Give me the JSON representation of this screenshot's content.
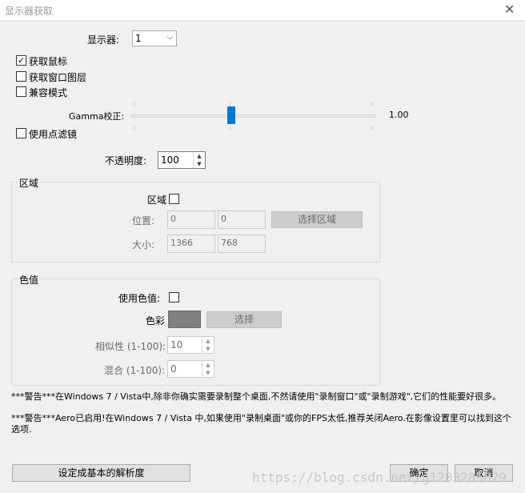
{
  "window": {
    "title": "显示器获取",
    "close_glyph": "✕"
  },
  "display": {
    "label": "显示器:",
    "selected": "1",
    "arrow": "⌵"
  },
  "options": {
    "capture_cursor": "获取鼠标",
    "capture_cursor_checked": true,
    "capture_layers": "获取窗口图层",
    "compat_mode": "兼容模式",
    "gamma_label": "Gamma校正:",
    "gamma_value": "1.00",
    "gamma_level": 0.41,
    "point_filter": "使用点滤镜",
    "opacity_label": "不透明度:",
    "opacity_value": "100",
    "check_glyph": "✓"
  },
  "region": {
    "group_label": "区域",
    "enable_label": "区域",
    "position_label": "位置:",
    "pos_x": "0",
    "pos_y": "0",
    "select_button": "选择区域",
    "size_label": "大小:",
    "width": "1366",
    "height": "768"
  },
  "color_key": {
    "group_label": "色值",
    "use_label": "使用色值:",
    "color_label": "色彩",
    "color_value": "#808080",
    "select_button": "选择",
    "similarity_label": "相似性 (1-100):",
    "similarity_value": "10",
    "blend_label": "混合 (1-100):",
    "blend_value": "0"
  },
  "warnings": {
    "line1": "***警告***在Windows 7 / Vista中,除非你确实需要录制整个桌面,不然请使用\"录制窗口\"或\"录制游戏\",它们的性能要好很多。",
    "line2": "***警告***Aero已启用!在Windows 7 / Vista 中,如果使用\"录制桌面\"或你的FPS太低,推荐关闭Aero.在影像设置里可以找到这个选项."
  },
  "footer": {
    "base_res_button": "设定成基本的解析度",
    "ok_button": "确定",
    "cancel_button": "取消"
  },
  "watermark": "https://blog.csdn.net/g1203285879",
  "spin": {
    "up": "▲",
    "down": "▼"
  }
}
